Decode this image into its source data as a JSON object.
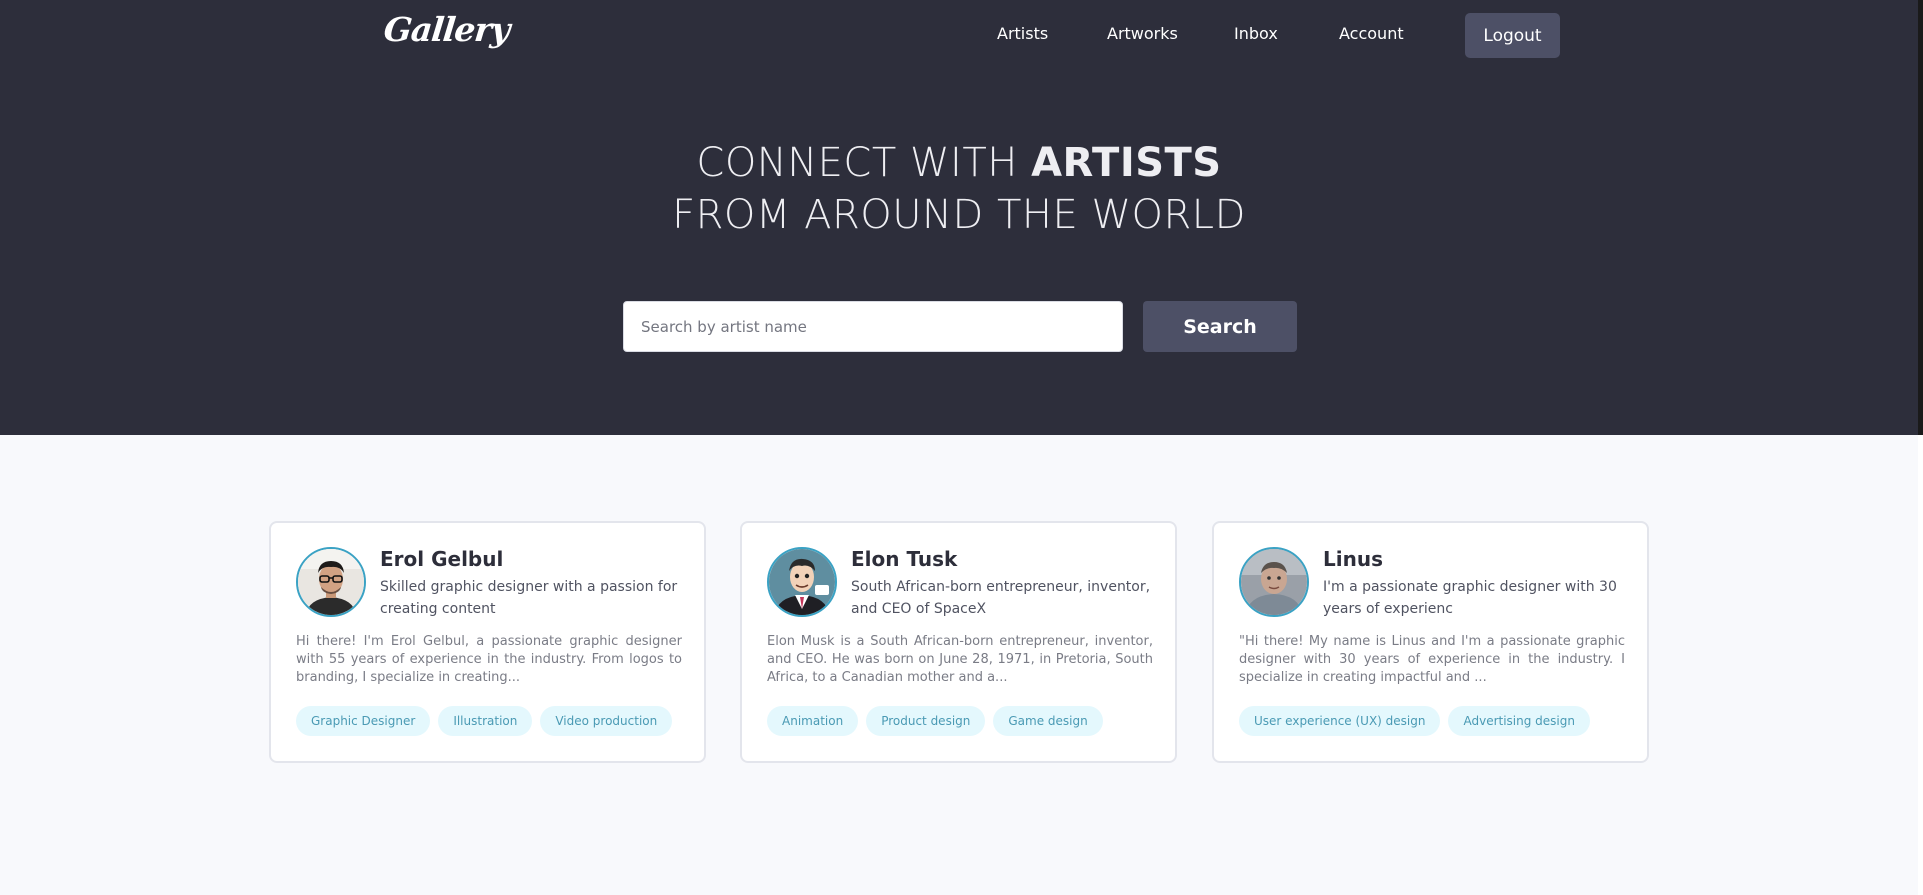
{
  "app": {
    "logo": "Gallery"
  },
  "nav": {
    "items": [
      {
        "label": "Artists"
      },
      {
        "label": "Artworks"
      },
      {
        "label": "Inbox"
      },
      {
        "label": "Account"
      }
    ],
    "logout_label": "Logout"
  },
  "hero": {
    "line1_prefix": "CONNECT WITH ",
    "line1_bold": "ARTISTS",
    "line2": "FROM AROUND THE WORLD"
  },
  "search": {
    "placeholder": "Search by artist name",
    "value": "",
    "button_label": "Search"
  },
  "artists": [
    {
      "name": "Erol Gelbul",
      "tagline": "Skilled graphic designer with a passion for creating content",
      "bio": "Hi there! I'm Erol Gelbul, a passionate graphic designer with 55 years of experience in the industry. From logos to branding, I specialize in creating...",
      "tags": [
        "Graphic Designer",
        "Illustration",
        "Video production"
      ]
    },
    {
      "name": "Elon Tusk",
      "tagline": "South African-born entrepreneur, inventor, and CEO of SpaceX",
      "bio": "Elon Musk is a South African-born entrepreneur, inventor, and CEO. He was born on June 28, 1971, in Pretoria, South Africa, to a Canadian mother and a...",
      "tags": [
        "Animation",
        "Product design",
        "Game design"
      ]
    },
    {
      "name": "Linus",
      "tagline": "I'm a passionate graphic designer with 30 years of experienc",
      "bio": "\"Hi there! My name is Linus and I'm a passionate graphic designer with 30 years of experience in the industry. I specialize in creating impactful and ...",
      "tags": [
        "User experience (UX) design",
        "Advertising design"
      ]
    }
  ],
  "colors": {
    "hero_bg": "#2d2e3b",
    "button_bg": "#4d5066",
    "page_bg": "#f8f9fc",
    "tag_bg": "#e4f8fd",
    "tag_text": "#4a9ab4",
    "avatar_ring": "#3aa2c4"
  }
}
